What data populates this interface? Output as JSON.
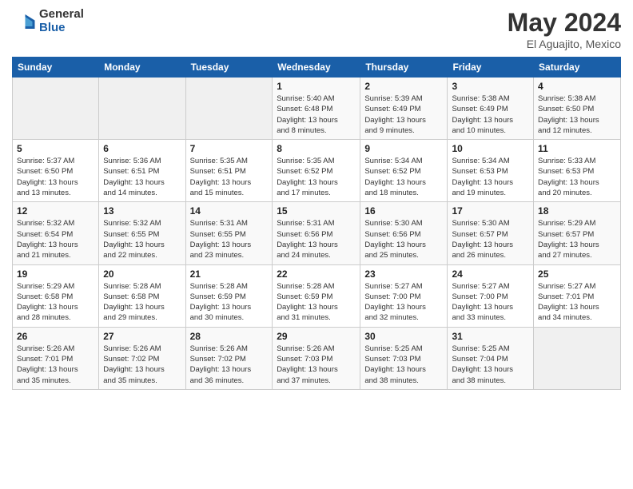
{
  "logo": {
    "general": "General",
    "blue": "Blue"
  },
  "title": {
    "month_year": "May 2024",
    "location": "El Aguajito, Mexico"
  },
  "headers": [
    "Sunday",
    "Monday",
    "Tuesday",
    "Wednesday",
    "Thursday",
    "Friday",
    "Saturday"
  ],
  "weeks": [
    [
      {
        "day": "",
        "info": ""
      },
      {
        "day": "",
        "info": ""
      },
      {
        "day": "",
        "info": ""
      },
      {
        "day": "1",
        "info": "Sunrise: 5:40 AM\nSunset: 6:48 PM\nDaylight: 13 hours\nand 8 minutes."
      },
      {
        "day": "2",
        "info": "Sunrise: 5:39 AM\nSunset: 6:49 PM\nDaylight: 13 hours\nand 9 minutes."
      },
      {
        "day": "3",
        "info": "Sunrise: 5:38 AM\nSunset: 6:49 PM\nDaylight: 13 hours\nand 10 minutes."
      },
      {
        "day": "4",
        "info": "Sunrise: 5:38 AM\nSunset: 6:50 PM\nDaylight: 13 hours\nand 12 minutes."
      }
    ],
    [
      {
        "day": "5",
        "info": "Sunrise: 5:37 AM\nSunset: 6:50 PM\nDaylight: 13 hours\nand 13 minutes."
      },
      {
        "day": "6",
        "info": "Sunrise: 5:36 AM\nSunset: 6:51 PM\nDaylight: 13 hours\nand 14 minutes."
      },
      {
        "day": "7",
        "info": "Sunrise: 5:35 AM\nSunset: 6:51 PM\nDaylight: 13 hours\nand 15 minutes."
      },
      {
        "day": "8",
        "info": "Sunrise: 5:35 AM\nSunset: 6:52 PM\nDaylight: 13 hours\nand 17 minutes."
      },
      {
        "day": "9",
        "info": "Sunrise: 5:34 AM\nSunset: 6:52 PM\nDaylight: 13 hours\nand 18 minutes."
      },
      {
        "day": "10",
        "info": "Sunrise: 5:34 AM\nSunset: 6:53 PM\nDaylight: 13 hours\nand 19 minutes."
      },
      {
        "day": "11",
        "info": "Sunrise: 5:33 AM\nSunset: 6:53 PM\nDaylight: 13 hours\nand 20 minutes."
      }
    ],
    [
      {
        "day": "12",
        "info": "Sunrise: 5:32 AM\nSunset: 6:54 PM\nDaylight: 13 hours\nand 21 minutes."
      },
      {
        "day": "13",
        "info": "Sunrise: 5:32 AM\nSunset: 6:55 PM\nDaylight: 13 hours\nand 22 minutes."
      },
      {
        "day": "14",
        "info": "Sunrise: 5:31 AM\nSunset: 6:55 PM\nDaylight: 13 hours\nand 23 minutes."
      },
      {
        "day": "15",
        "info": "Sunrise: 5:31 AM\nSunset: 6:56 PM\nDaylight: 13 hours\nand 24 minutes."
      },
      {
        "day": "16",
        "info": "Sunrise: 5:30 AM\nSunset: 6:56 PM\nDaylight: 13 hours\nand 25 minutes."
      },
      {
        "day": "17",
        "info": "Sunrise: 5:30 AM\nSunset: 6:57 PM\nDaylight: 13 hours\nand 26 minutes."
      },
      {
        "day": "18",
        "info": "Sunrise: 5:29 AM\nSunset: 6:57 PM\nDaylight: 13 hours\nand 27 minutes."
      }
    ],
    [
      {
        "day": "19",
        "info": "Sunrise: 5:29 AM\nSunset: 6:58 PM\nDaylight: 13 hours\nand 28 minutes."
      },
      {
        "day": "20",
        "info": "Sunrise: 5:28 AM\nSunset: 6:58 PM\nDaylight: 13 hours\nand 29 minutes."
      },
      {
        "day": "21",
        "info": "Sunrise: 5:28 AM\nSunset: 6:59 PM\nDaylight: 13 hours\nand 30 minutes."
      },
      {
        "day": "22",
        "info": "Sunrise: 5:28 AM\nSunset: 6:59 PM\nDaylight: 13 hours\nand 31 minutes."
      },
      {
        "day": "23",
        "info": "Sunrise: 5:27 AM\nSunset: 7:00 PM\nDaylight: 13 hours\nand 32 minutes."
      },
      {
        "day": "24",
        "info": "Sunrise: 5:27 AM\nSunset: 7:00 PM\nDaylight: 13 hours\nand 33 minutes."
      },
      {
        "day": "25",
        "info": "Sunrise: 5:27 AM\nSunset: 7:01 PM\nDaylight: 13 hours\nand 34 minutes."
      }
    ],
    [
      {
        "day": "26",
        "info": "Sunrise: 5:26 AM\nSunset: 7:01 PM\nDaylight: 13 hours\nand 35 minutes."
      },
      {
        "day": "27",
        "info": "Sunrise: 5:26 AM\nSunset: 7:02 PM\nDaylight: 13 hours\nand 35 minutes."
      },
      {
        "day": "28",
        "info": "Sunrise: 5:26 AM\nSunset: 7:02 PM\nDaylight: 13 hours\nand 36 minutes."
      },
      {
        "day": "29",
        "info": "Sunrise: 5:26 AM\nSunset: 7:03 PM\nDaylight: 13 hours\nand 37 minutes."
      },
      {
        "day": "30",
        "info": "Sunrise: 5:25 AM\nSunset: 7:03 PM\nDaylight: 13 hours\nand 38 minutes."
      },
      {
        "day": "31",
        "info": "Sunrise: 5:25 AM\nSunset: 7:04 PM\nDaylight: 13 hours\nand 38 minutes."
      },
      {
        "day": "",
        "info": ""
      }
    ]
  ]
}
